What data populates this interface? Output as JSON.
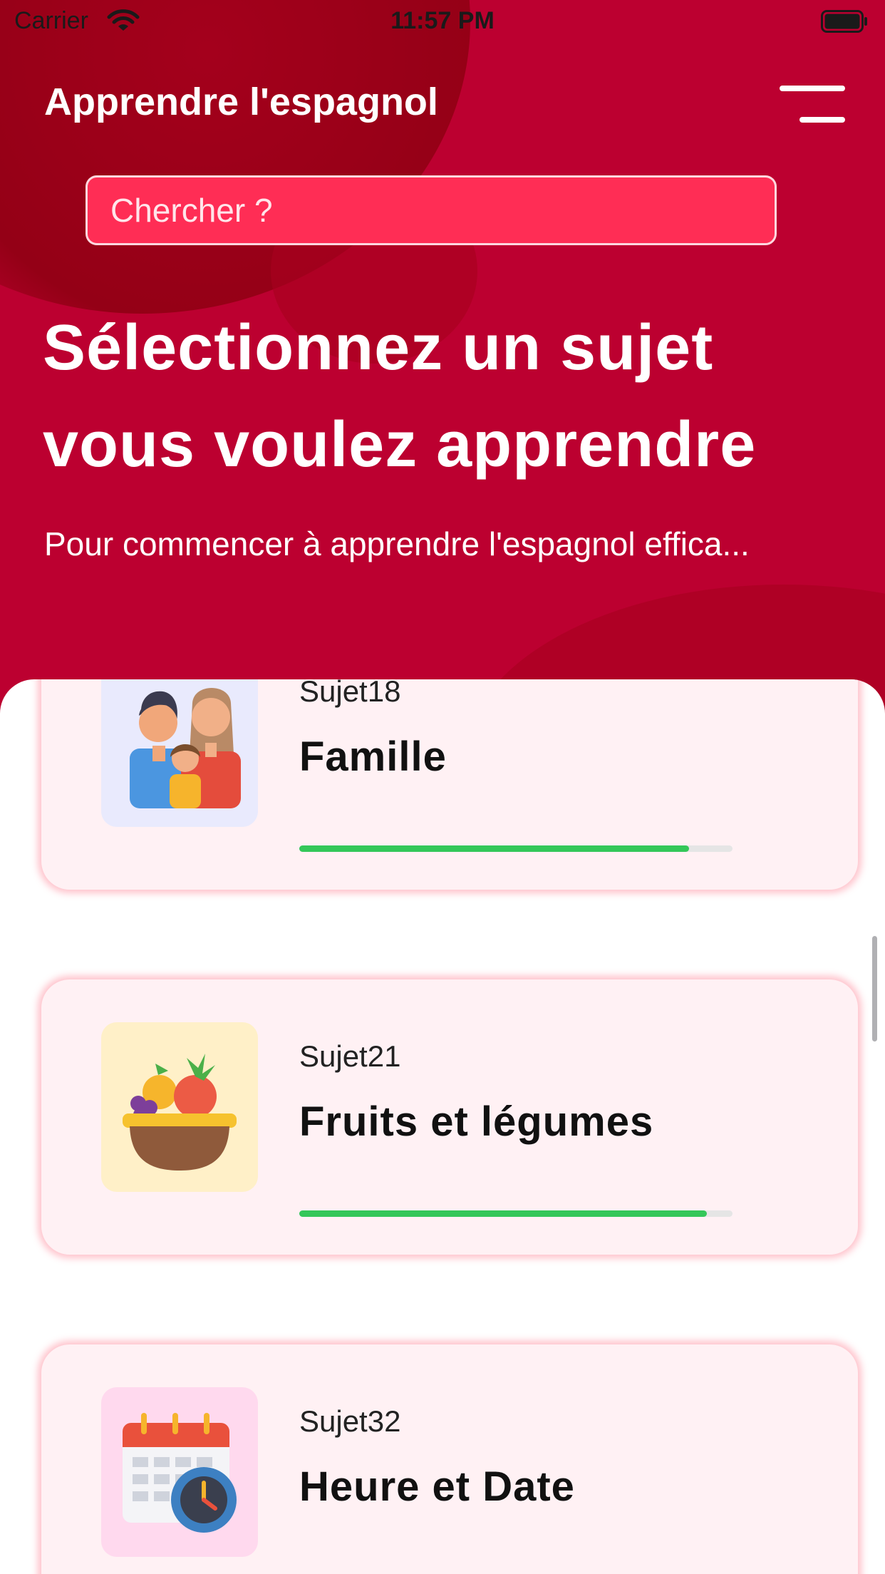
{
  "status_bar": {
    "carrier": "Carrier",
    "time": "11:57 PM"
  },
  "header": {
    "title": "Apprendre l'espagnol",
    "search_placeholder": "Chercher ?",
    "headline_line1": "Sélectionnez un sujet",
    "headline_line2": "vous voulez apprendre",
    "subtitle": "Pour commencer à apprendre l'espagnol effica..."
  },
  "colors": {
    "header": "#bc0030",
    "search": "#ff2d55",
    "progress": "#34c759",
    "card": "#fff1f4"
  },
  "topics": [
    {
      "code": "Sujet18",
      "name": "Famille",
      "icon": "family-icon",
      "progress": 0.9
    },
    {
      "code": "Sujet21",
      "name": "Fruits et légumes",
      "icon": "fruit-basket-icon",
      "progress": 0.94
    },
    {
      "code": "Sujet32",
      "name": "Heure et Date",
      "icon": "calendar-clock-icon",
      "progress": null
    }
  ]
}
